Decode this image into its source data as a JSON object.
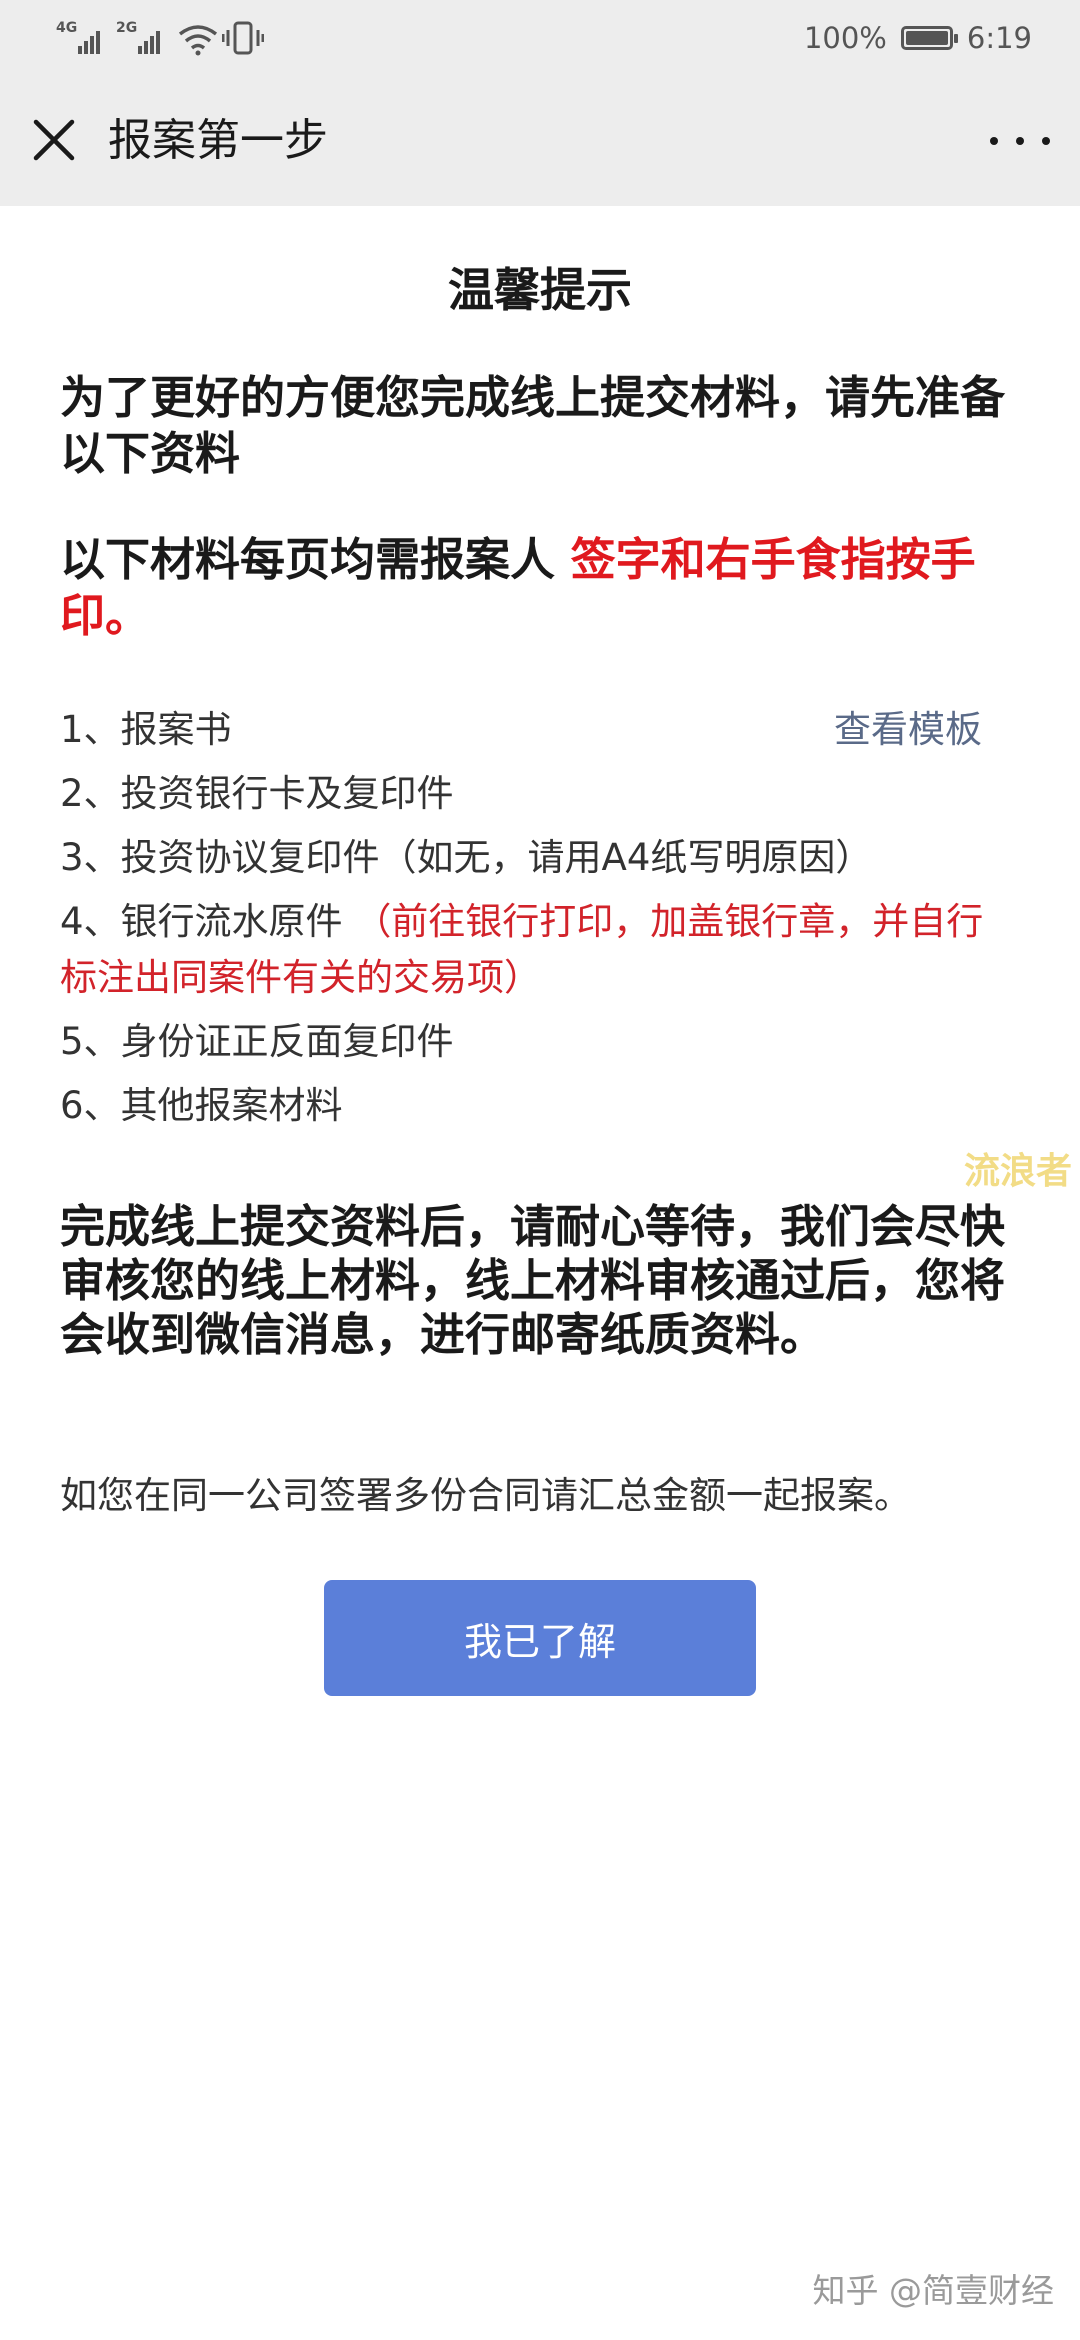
{
  "status_bar": {
    "signal_1_type": "4G",
    "signal_2_type": "2G",
    "battery_percent": "100%",
    "time": "6:19"
  },
  "nav": {
    "title": "报案第一步"
  },
  "notice": {
    "heading": "温馨提示",
    "intro": "为了更好的方便您完成线上提交材料，请先准备以下资料",
    "sign_prefix": "以下材料每页均需报案人 ",
    "sign_highlight": "签字和右手食指按手印。",
    "items": [
      {
        "text": "1、报案书",
        "link": "查看模板"
      },
      {
        "text": "2、投资银行卡及复印件"
      },
      {
        "text": "3、投资协议复印件（如无，请用A4纸写明原因）"
      },
      {
        "text": "4、银行流水原件 ",
        "note": "（前往银行打印，加盖银行章，并自行标注出同案件有关的交易项）"
      },
      {
        "text": "5、身份证正反面复印件"
      },
      {
        "text": "6、其他报案材料"
      }
    ],
    "after_submit": "完成线上提交资料后，请耐心等待，我们会尽快审核您的线上材料，线上材料审核通过后，您将会收到微信消息，进行邮寄纸质资料。",
    "merge_note": "如您在同一公司签署多份合同请汇总金额一起报案。",
    "ack_button": "我已了解"
  },
  "watermarks": {
    "side": "流浪者",
    "footer": "知乎 @简壹财经"
  },
  "colors": {
    "highlight_red": "#e0191e",
    "note_red": "#d2232a",
    "button_blue": "#5b7fd9",
    "link_gray_blue": "#5a6a88",
    "bar_gray": "#ededed"
  }
}
